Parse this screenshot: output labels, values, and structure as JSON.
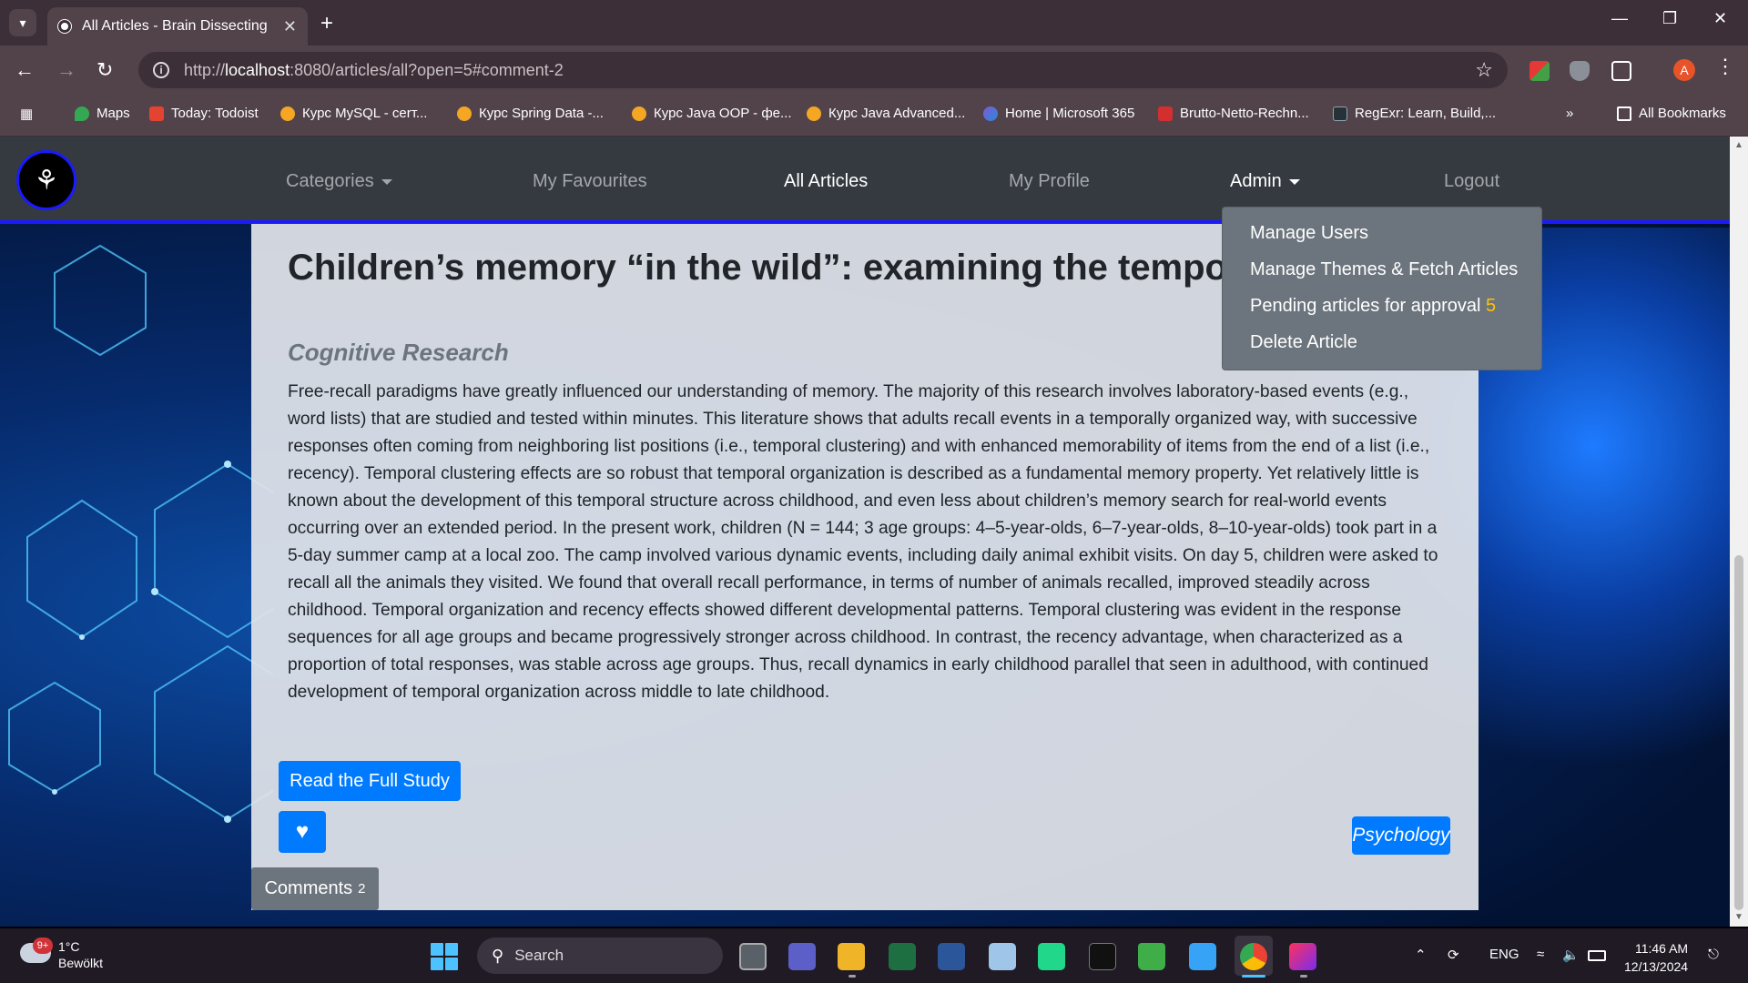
{
  "browser": {
    "tab_title": "All Articles - Brain Dissecting",
    "url_prefix": "http://",
    "url_host": "localhost",
    "url_rest": ":8080/articles/all?open=5#comment-2",
    "bookmarks": [
      "Maps",
      "Today: Todoist",
      "Курс MySQL - сеrт...",
      "Курс Spring Data -...",
      "Курс Java OOP - фе...",
      "Курс Java Advanced...",
      "Home | Microsoft 365",
      "Brutto-Netto-Rechn...",
      "RegExr: Learn, Build,..."
    ],
    "all_bookmarks": "All Bookmarks",
    "profile_initial": "A"
  },
  "nav": {
    "categories": "Categories",
    "favourites": "My Favourites",
    "all_articles": "All Articles",
    "profile": "My Profile",
    "admin": "Admin",
    "logout": "Logout"
  },
  "admin_menu": {
    "manage_users": "Manage Users",
    "manage_themes": "Manage Themes & Fetch Articles",
    "pending": "Pending articles for approval",
    "pending_count": "5",
    "delete_article": "Delete Article"
  },
  "article": {
    "title": "Children’s memory “in the wild”: examining the temporal organization of free recall from a week-long camp at a lo",
    "journal": "Cognitive Research",
    "abstract": "Free-recall paradigms have greatly influenced our understanding of memory. The majority of this research involves laboratory-based events (e.g., word lists) that are studied and tested within minutes. This literature shows that adults recall events in a temporally organized way, with successive responses often coming from neighboring list positions (i.e., temporal clustering) and with enhanced memorability of items from the end of a list (i.e., recency). Temporal clustering effects are so robust that temporal organization is described as a fundamental memory property. Yet relatively little is known about the development of this temporal structure across childhood, and even less about children’s memory search for real-world events occurring over an extended period. In the present work, children (N = 144; 3 age groups: 4–5-year-olds, 6–7-year-olds, 8–10-year-olds) took part in a 5-day summer camp at a local zoo. The camp involved various dynamic events, including daily animal exhibit visits. On day 5, children were asked to recall all the animals they visited. We found that overall recall performance, in terms of number of animals recalled, improved steadily across childhood. Temporal organization and recency effects showed different developmental patterns. Temporal clustering was evident in the response sequences for all age groups and became progressively stronger across childhood. In contrast, the recency advantage, when characterized as a proportion of total responses, was stable across age groups. Thus, recall dynamics in early childhood parallel that seen in adulthood, with continued development of temporal organization across middle to late childhood.",
    "read_button": "Read the Full Study",
    "category_tag": "Psychology",
    "comments_label": "Comments",
    "comments_count": "2"
  },
  "taskbar": {
    "weather_temp": "1°C",
    "weather_cond": "Bewölkt",
    "weather_badge": "9+",
    "search_placeholder": "Search",
    "lang": "ENG",
    "time": "11:46 AM",
    "date": "12/13/2024"
  },
  "colors": {
    "primary": "#007bff",
    "navbar": "#343a40",
    "dropdown": "#6c757d",
    "badge_warning": "#ffc107"
  }
}
